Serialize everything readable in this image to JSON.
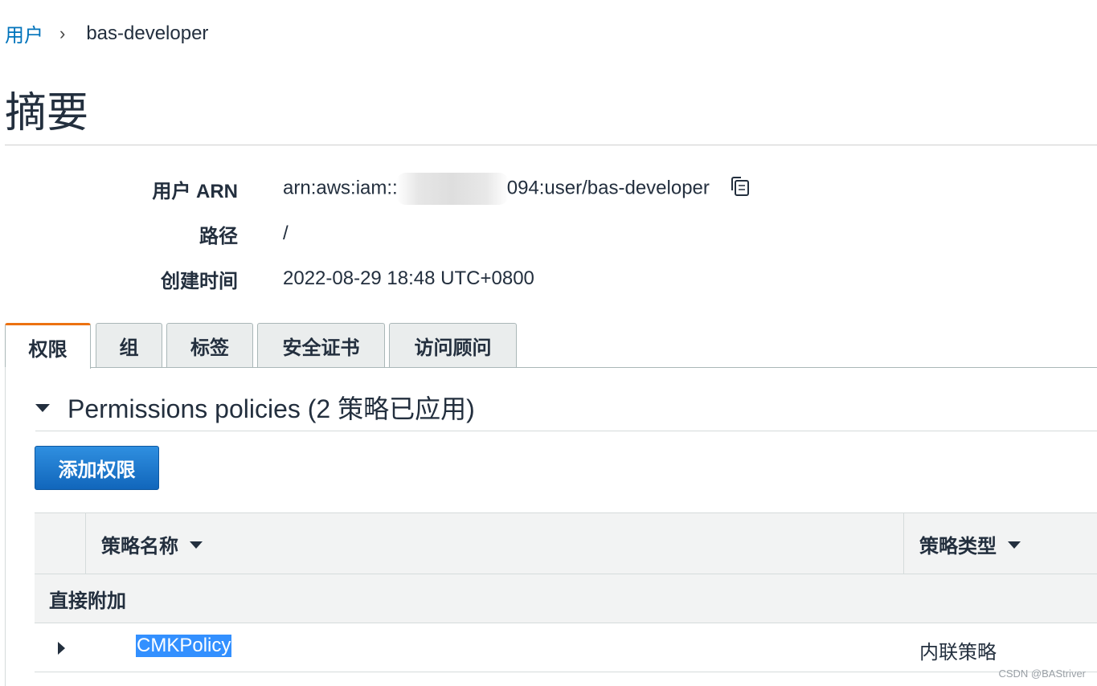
{
  "breadcrumb": {
    "parent": "用户",
    "separator": "›",
    "current": "bas-developer"
  },
  "page_title": "摘要",
  "summary": {
    "arn_label": "用户 ARN",
    "arn_prefix": "arn:aws:iam::",
    "arn_suffix": "094:user/bas-developer",
    "path_label": "路径",
    "path_value": "/",
    "created_label": "创建时间",
    "created_value": "2022-08-29 18:48 UTC+0800"
  },
  "tabs": [
    {
      "label": "权限",
      "active": true
    },
    {
      "label": "组",
      "active": false
    },
    {
      "label": "标签",
      "active": false
    },
    {
      "label": "安全证书",
      "active": false
    },
    {
      "label": "访问顾问",
      "active": false
    }
  ],
  "permissions": {
    "section_title": "Permissions policies (2 策略已应用)",
    "add_button": "添加权限",
    "table": {
      "col_name": "策略名称",
      "col_type": "策略类型",
      "group_label": "直接附加",
      "rows": [
        {
          "name": "CMKPolicy",
          "type": "内联策略"
        }
      ]
    }
  },
  "watermark": "CSDN @BAStriver",
  "colors": {
    "link": "#0073bb",
    "active_tab": "#ec7211",
    "primary_button": "#1166bb",
    "selection": "#3390ff"
  },
  "icons": [
    "copy-icon",
    "caret-down-icon",
    "sort-icon",
    "expand-icon"
  ]
}
